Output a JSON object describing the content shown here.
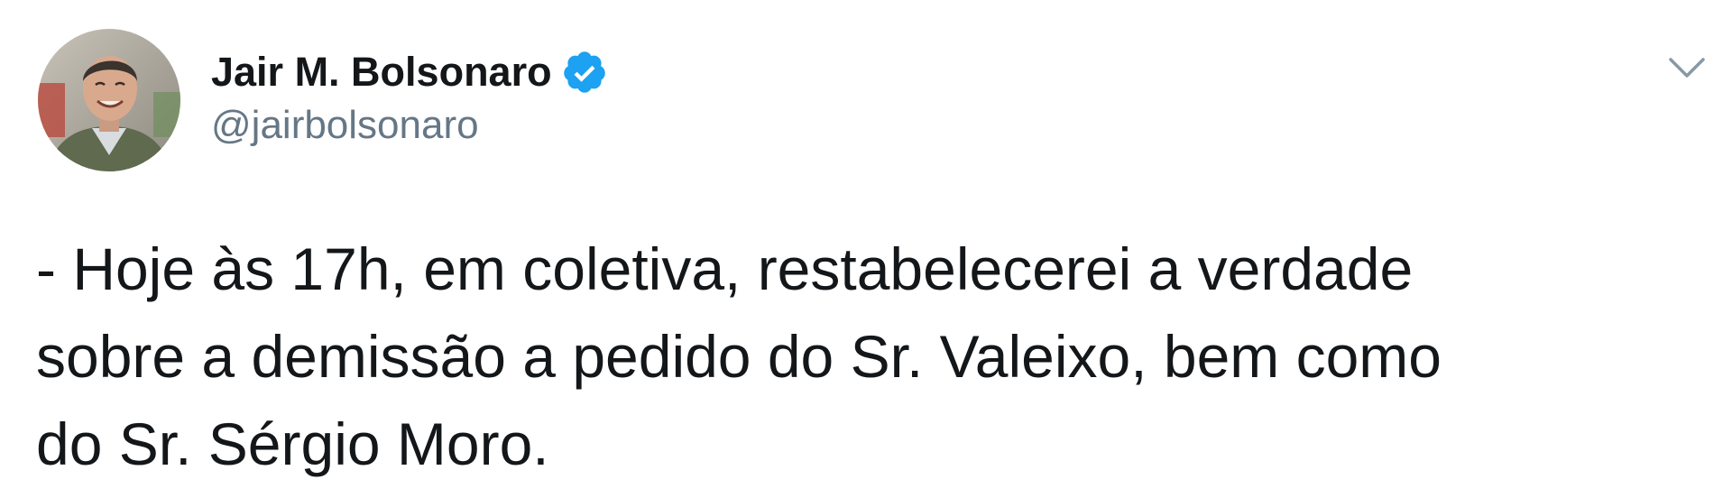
{
  "author": {
    "display_name": "Jair M. Bolsonaro",
    "handle": "@jairbolsonaro",
    "verified": true,
    "avatar_icon": "profile-photo",
    "verified_icon": "verified-badge-icon"
  },
  "tweet": {
    "text_lines": [
      "- Hoje às 17h, em coletiva, restabelecerei a verdade",
      "sobre a demissão a pedido do Sr. Valeixo, bem como",
      "do Sr. Sérgio Moro."
    ]
  },
  "menu": {
    "icon": "chevron-down-icon"
  },
  "colors": {
    "text_primary": "#14171a",
    "text_secondary": "#657786",
    "verified_blue": "#1da1f2",
    "chevron": "#8899a6"
  }
}
